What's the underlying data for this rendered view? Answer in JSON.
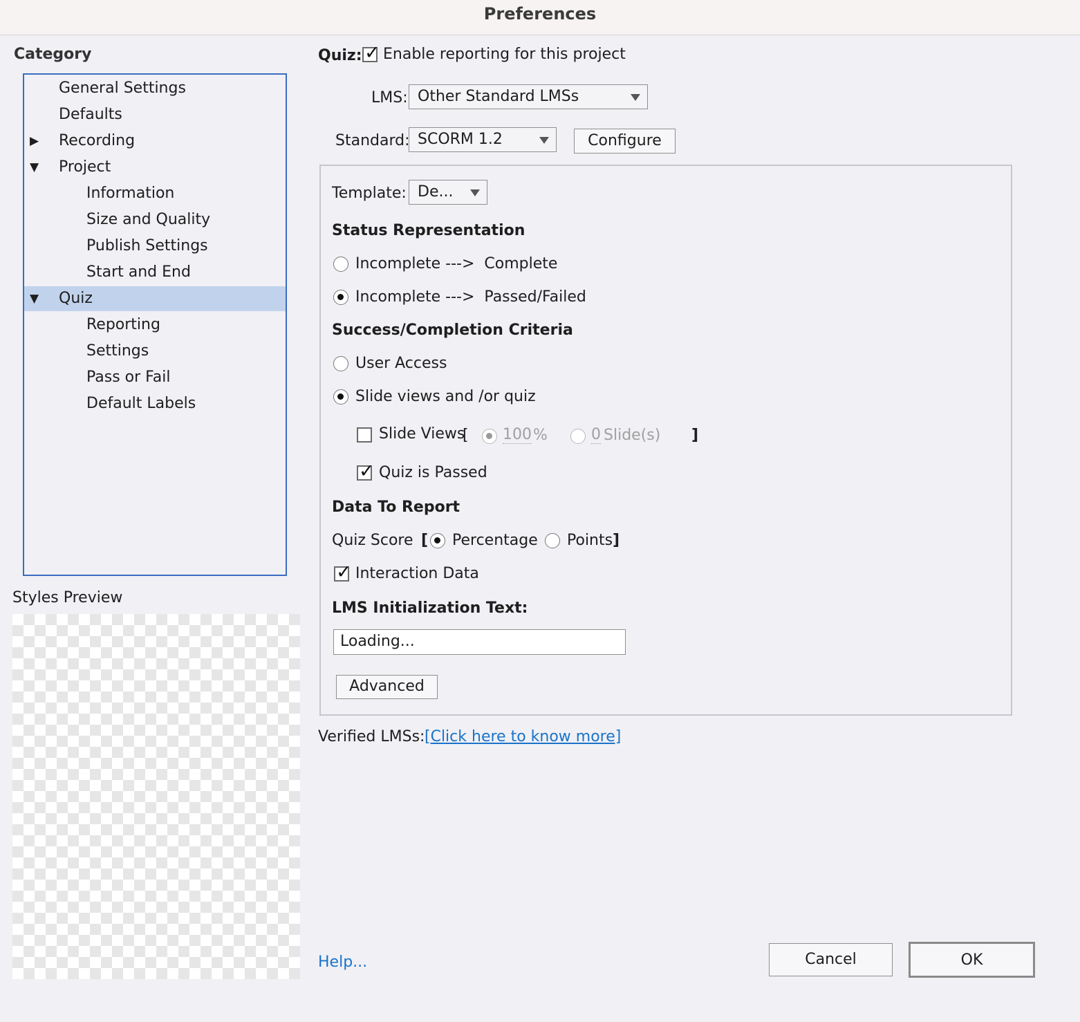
{
  "window": {
    "title": "Preferences"
  },
  "sidebar": {
    "category_label": "Category",
    "items": [
      {
        "label": "General Settings"
      },
      {
        "label": "Defaults"
      },
      {
        "label": "Recording"
      },
      {
        "label": "Project"
      },
      {
        "label": "Information"
      },
      {
        "label": "Size and Quality"
      },
      {
        "label": "Publish Settings"
      },
      {
        "label": "Start and End"
      },
      {
        "label": "Quiz"
      },
      {
        "label": "Reporting"
      },
      {
        "label": "Settings"
      },
      {
        "label": "Pass or Fail"
      },
      {
        "label": "Default Labels"
      }
    ],
    "styles_preview_label": "Styles Preview"
  },
  "quiz": {
    "section_label": "Quiz:",
    "enable_reporting": {
      "label": "Enable reporting for this project",
      "checked": true
    },
    "lms": {
      "label": "LMS:",
      "value": "Other Standard LMSs"
    },
    "standard": {
      "label": "Standard:",
      "value": "SCORM 1.2"
    },
    "configure_label": "Configure",
    "template": {
      "label": "Template:",
      "value": "De..."
    },
    "status_representation": {
      "heading": "Status Representation",
      "options": [
        {
          "label": "Incomplete --->  Complete",
          "selected": false
        },
        {
          "label": "Incomplete --->  Passed/Failed",
          "selected": true
        }
      ]
    },
    "criteria": {
      "heading": "Success/Completion Criteria",
      "options": [
        {
          "label": "User Access",
          "selected": false
        },
        {
          "label": "Slide views and /or quiz",
          "selected": true
        }
      ],
      "slide_views": {
        "label": "Slide Views",
        "open_bracket": "[",
        "close_bracket": "]",
        "checked": false,
        "percent": {
          "value": "100",
          "unit": "%",
          "selected": true
        },
        "slides": {
          "value": "0",
          "unit": "Slide(s)",
          "selected": false
        }
      },
      "quiz_passed": {
        "label": "Quiz is Passed",
        "checked": true
      }
    },
    "data_to_report": {
      "heading": "Data To Report",
      "quiz_score_label": "Quiz Score",
      "open_bracket": "[",
      "close_bracket": "]",
      "percentage": {
        "label": "Percentage",
        "selected": true
      },
      "points": {
        "label": "Points",
        "selected": false
      },
      "interaction_data": {
        "label": "Interaction Data",
        "checked": true
      }
    },
    "lms_init": {
      "label": "LMS Initialization Text:",
      "value": "Loading..."
    },
    "advanced_label": "Advanced",
    "verified": {
      "label": "Verified LMSs:",
      "link": "[Click here to know more]"
    }
  },
  "footer": {
    "help": "Help...",
    "cancel": "Cancel",
    "ok": "OK"
  },
  "colors": {
    "selection": "#c1d3ec",
    "tree_border": "#3a6dc0",
    "link": "#1a73c8"
  }
}
